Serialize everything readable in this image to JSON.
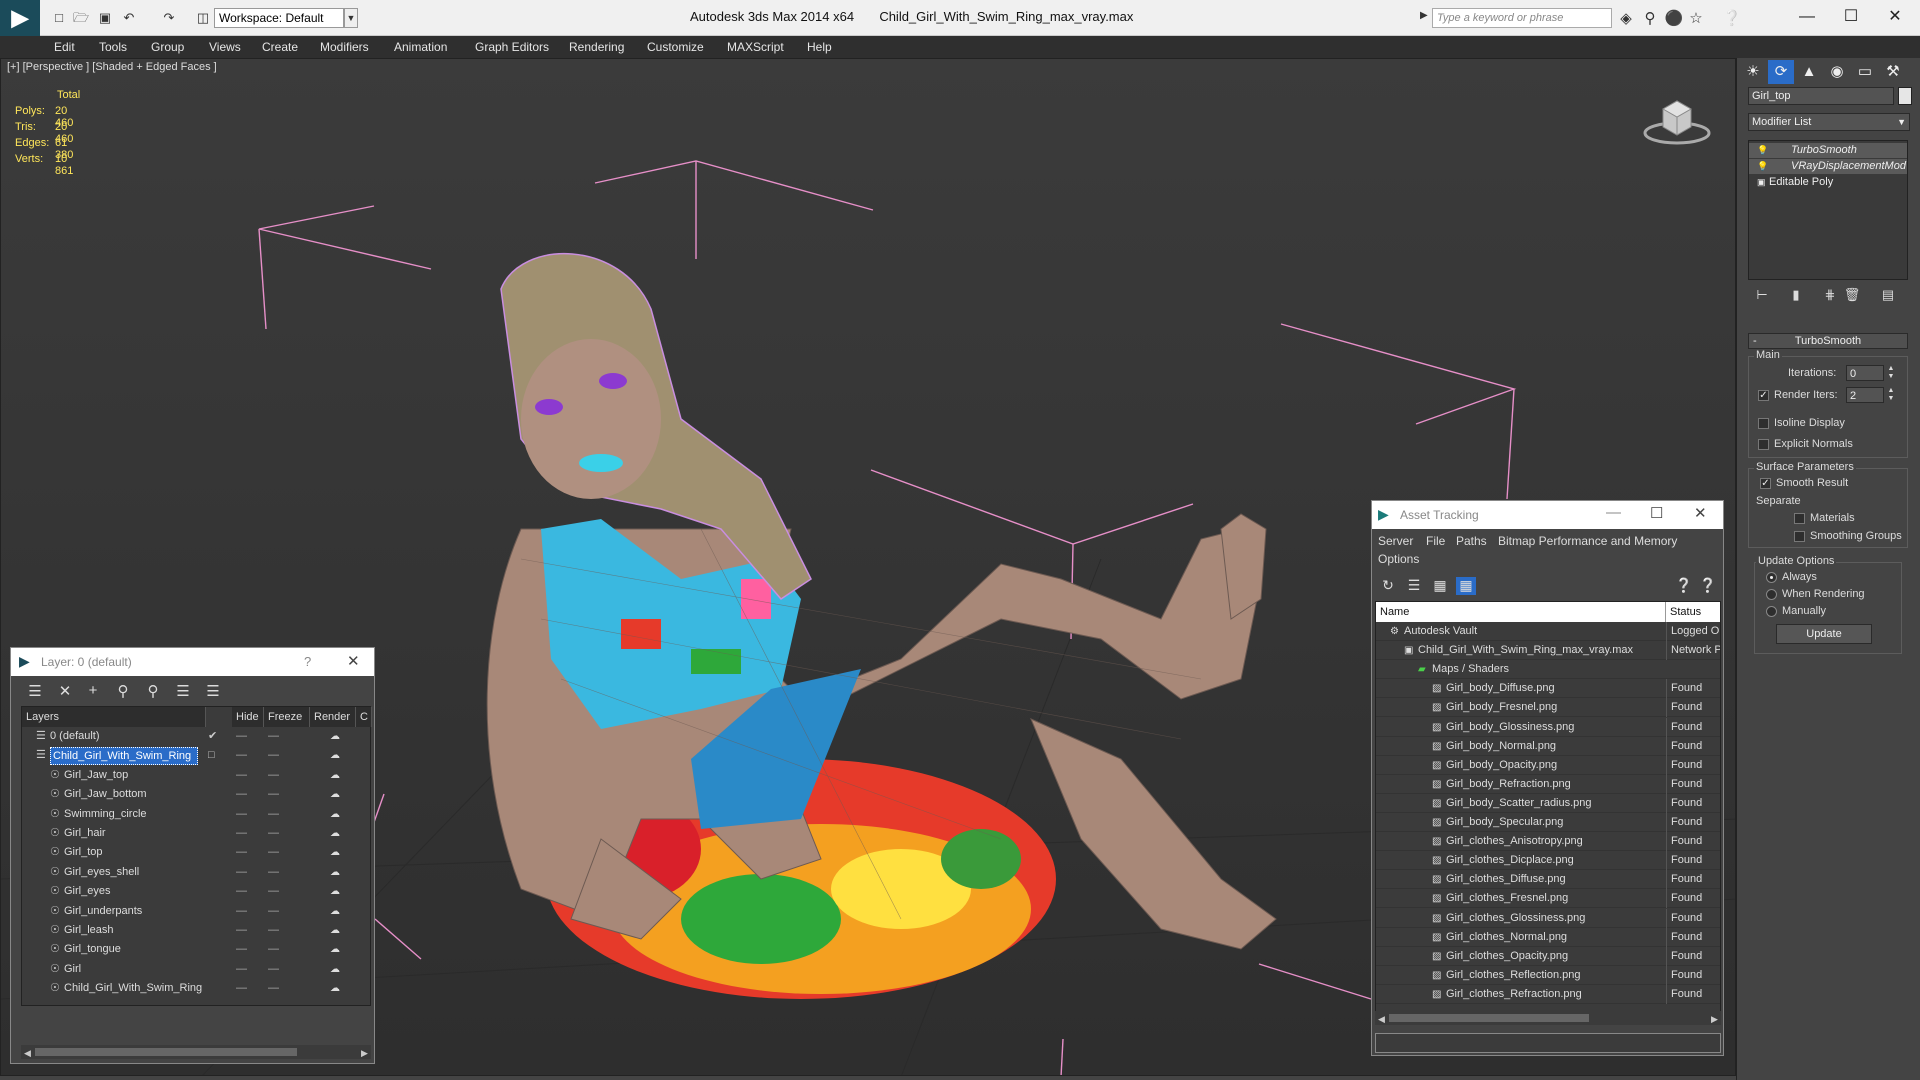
{
  "titlebar": {
    "app_title": "Autodesk 3ds Max  2014 x64",
    "file_name": "Child_Girl_With_Swim_Ring_max_vray.max",
    "workspace_label": "Workspace: Default",
    "search_placeholder": "Type a keyword or phrase"
  },
  "menu": [
    "Edit",
    "Tools",
    "Group",
    "Views",
    "Create",
    "Modifiers",
    "Animation",
    "Graph Editors",
    "Rendering",
    "Customize",
    "MAXScript",
    "Help"
  ],
  "viewport": {
    "label": "[+] [Perspective ] [Shaded + Edged Faces ]",
    "stats": {
      "header": "Total",
      "polys_label": "Polys:",
      "polys": "20 460",
      "tris_label": "Tris:",
      "tris": "20 460",
      "edges_label": "Edges:",
      "edges": "61 380",
      "verts_label": "Verts:",
      "verts": "10 861"
    }
  },
  "command_panel": {
    "object_name": "Girl_top",
    "modifier_list": "Modifier List",
    "stack": [
      "TurboSmooth",
      "VRayDisplacementMod",
      "Editable Poly"
    ],
    "turbosmooth": {
      "title": "TurboSmooth",
      "main_label": "Main",
      "iterations_label": "Iterations:",
      "iterations": "0",
      "render_iters_label": "Render Iters:",
      "render_iters": "2",
      "render_iters_checked": true,
      "isoline_label": "Isoline Display",
      "explicit_normals_label": "Explicit Normals",
      "surface_params_label": "Surface Parameters",
      "smooth_result_label": "Smooth Result",
      "smooth_result_checked": true,
      "separate_label": "Separate",
      "materials_label": "Materials",
      "smoothing_groups_label": "Smoothing Groups",
      "update_options_label": "Update Options",
      "always_label": "Always",
      "when_rendering_label": "When Rendering",
      "manually_label": "Manually",
      "selected_update_option": "Always",
      "update_button": "Update"
    }
  },
  "layer_window": {
    "title": "Layer: 0 (default)",
    "help": "?",
    "columns": [
      "Layers",
      "Hide",
      "Freeze",
      "Render",
      "C"
    ],
    "rows": [
      {
        "name": "0 (default)",
        "level": 0,
        "active": true,
        "selected": false
      },
      {
        "name": "Child_Girl_With_Swim_Ring",
        "level": 0,
        "active": false,
        "selected": true
      },
      {
        "name": "Girl_Jaw_top",
        "level": 1,
        "selected": false
      },
      {
        "name": "Girl_Jaw_bottom",
        "level": 1,
        "selected": false
      },
      {
        "name": "Swimming_circle",
        "level": 1,
        "selected": false
      },
      {
        "name": "Girl_hair",
        "level": 1,
        "selected": false
      },
      {
        "name": "Girl_top",
        "level": 1,
        "selected": false
      },
      {
        "name": "Girl_eyes_shell",
        "level": 1,
        "selected": false
      },
      {
        "name": "Girl_eyes",
        "level": 1,
        "selected": false
      },
      {
        "name": "Girl_underpants",
        "level": 1,
        "selected": false
      },
      {
        "name": "Girl_leash",
        "level": 1,
        "selected": false
      },
      {
        "name": "Girl_tongue",
        "level": 1,
        "selected": false
      },
      {
        "name": "Girl",
        "level": 1,
        "selected": false
      },
      {
        "name": "Child_Girl_With_Swim_Ring",
        "level": 1,
        "selected": false
      }
    ]
  },
  "asset_window": {
    "title": "Asset Tracking",
    "menu": [
      "Server",
      "File",
      "Paths",
      "Bitmap Performance and Memory",
      "Options"
    ],
    "columns": [
      "Name",
      "Status"
    ],
    "rows": [
      {
        "name": "Autodesk Vault",
        "status": "Logged Ou",
        "level": 0,
        "icon": "vault-icon"
      },
      {
        "name": "Child_Girl_With_Swim_Ring_max_vray.max",
        "status": "Network P",
        "level": 1,
        "icon": "max-file-icon"
      },
      {
        "name": "Maps / Shaders",
        "status": "",
        "level": 2,
        "icon": "maps-icon"
      },
      {
        "name": "Girl_body_Diffuse.png",
        "status": "Found",
        "level": 3,
        "icon": "bitmap-icon"
      },
      {
        "name": "Girl_body_Fresnel.png",
        "status": "Found",
        "level": 3,
        "icon": "bitmap-icon"
      },
      {
        "name": "Girl_body_Glossiness.png",
        "status": "Found",
        "level": 3,
        "icon": "bitmap-icon"
      },
      {
        "name": "Girl_body_Normal.png",
        "status": "Found",
        "level": 3,
        "icon": "bitmap-icon"
      },
      {
        "name": "Girl_body_Opacity.png",
        "status": "Found",
        "level": 3,
        "icon": "bitmap-icon"
      },
      {
        "name": "Girl_body_Refraction.png",
        "status": "Found",
        "level": 3,
        "icon": "bitmap-icon"
      },
      {
        "name": "Girl_body_Scatter_radius.png",
        "status": "Found",
        "level": 3,
        "icon": "bitmap-icon"
      },
      {
        "name": "Girl_body_Specular.png",
        "status": "Found",
        "level": 3,
        "icon": "bitmap-icon"
      },
      {
        "name": "Girl_clothes_Anisotropy.png",
        "status": "Found",
        "level": 3,
        "icon": "bitmap-icon"
      },
      {
        "name": "Girl_clothes_Dicplace.png",
        "status": "Found",
        "level": 3,
        "icon": "bitmap-icon"
      },
      {
        "name": "Girl_clothes_Diffuse.png",
        "status": "Found",
        "level": 3,
        "icon": "bitmap-icon"
      },
      {
        "name": "Girl_clothes_Fresnel.png",
        "status": "Found",
        "level": 3,
        "icon": "bitmap-icon"
      },
      {
        "name": "Girl_clothes_Glossiness.png",
        "status": "Found",
        "level": 3,
        "icon": "bitmap-icon"
      },
      {
        "name": "Girl_clothes_Normal.png",
        "status": "Found",
        "level": 3,
        "icon": "bitmap-icon"
      },
      {
        "name": "Girl_clothes_Opacity.png",
        "status": "Found",
        "level": 3,
        "icon": "bitmap-icon"
      },
      {
        "name": "Girl_clothes_Reflection.png",
        "status": "Found",
        "level": 3,
        "icon": "bitmap-icon"
      },
      {
        "name": "Girl_clothes_Refraction.png",
        "status": "Found",
        "level": 3,
        "icon": "bitmap-icon"
      }
    ]
  },
  "colors": {
    "selection": "#2a6cc8",
    "bounding_box": "#e68fc8",
    "stats_text": "#ffe65a",
    "wireframe_hair": "#c98ee0"
  }
}
